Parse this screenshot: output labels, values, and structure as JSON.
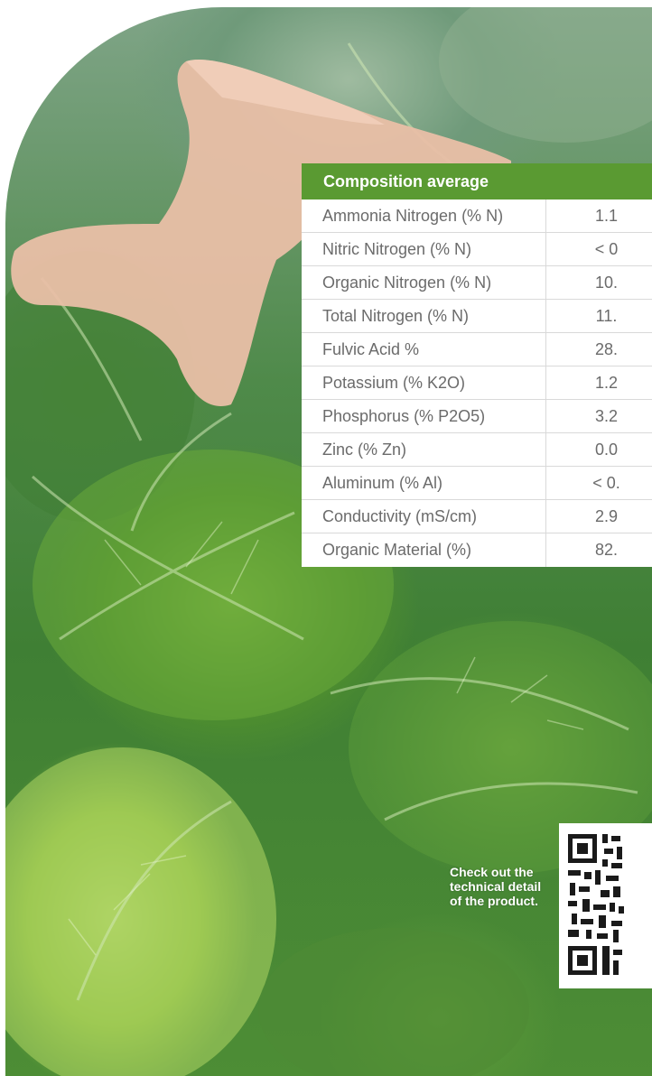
{
  "composition": {
    "title": "Composition average",
    "rows": [
      {
        "label": "Ammonia Nitrogen (% N)",
        "value": "1.1"
      },
      {
        "label": "Nitric Nitrogen (% N)",
        "value": "< 0"
      },
      {
        "label": "Organic Nitrogen (% N)",
        "value": "10."
      },
      {
        "label": "Total Nitrogen (% N)",
        "value": "11."
      },
      {
        "label": "Fulvic Acid %",
        "value": "28."
      },
      {
        "label": "Potassium (% K2O)",
        "value": "1.2"
      },
      {
        "label": "Phosphorus (% P2O5)",
        "value": "3.2"
      },
      {
        "label": "Zinc (% Zn)",
        "value": "0.0"
      },
      {
        "label": "Aluminum (% Al)",
        "value": "< 0."
      },
      {
        "label": "Conductivity (mS/cm)",
        "value": "2.9"
      },
      {
        "label": "Organic Material (%)",
        "value": "82."
      }
    ]
  },
  "qr": {
    "caption_line1": "Check out the",
    "caption_line2": "technical detail",
    "caption_line3": "of the product."
  },
  "colors": {
    "header_green": "#5a9a32",
    "text_gray": "#6b6b6b"
  }
}
